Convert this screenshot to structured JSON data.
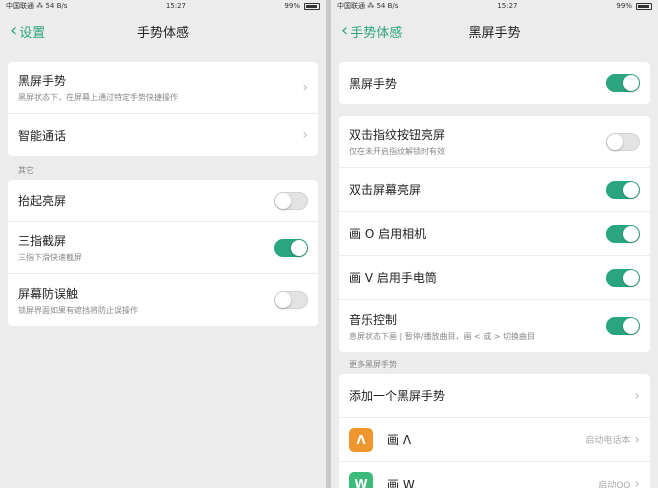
{
  "left": {
    "status": {
      "left": "中国联通 ⁂ 54 B/s",
      "time": "15:27",
      "right": "99%"
    },
    "nav": {
      "back_label": "设置",
      "title": "手势体感"
    },
    "items": [
      {
        "title": "黑屏手势",
        "sub": "黑屏状态下，在屏幕上通过特定手势快捷操作"
      },
      {
        "title": "智能通话"
      }
    ],
    "section_label": "其它",
    "toggles": [
      {
        "title": "抬起亮屏",
        "sub": "",
        "on": false
      },
      {
        "title": "三指截屏",
        "sub": "三指下滑快速截屏",
        "on": true
      },
      {
        "title": "屏幕防误触",
        "sub": "锁屏界面如果有遮挡将防止误操作",
        "on": false
      }
    ]
  },
  "right": {
    "status": {
      "left": "中国联通 ⁂ 54 B/s",
      "time": "15:27",
      "right": "99%"
    },
    "nav": {
      "back_label": "手势体感",
      "title": "黑屏手势"
    },
    "master": {
      "title": "黑屏手势",
      "on": true
    },
    "toggles": [
      {
        "title": "双击指纹按钮亮屏",
        "sub": "仅在未开启指纹解锁时有效",
        "on": false
      },
      {
        "title": "双击屏幕亮屏",
        "sub": "",
        "on": true
      },
      {
        "title": "画 O 启用相机",
        "sub": "",
        "on": true
      },
      {
        "title": "画 V 启用手电筒",
        "sub": "",
        "on": true
      },
      {
        "title": "音乐控制",
        "sub": "息屏状态下画 | 暂停/播放曲目，画 < 或 > 切换曲目",
        "on": true
      }
    ],
    "section_label": "更多黑屏手势",
    "add_label": "添加一个黑屏手势",
    "custom": [
      {
        "icon": "Λ",
        "icon_color": "#f0962e",
        "title": "画 Λ",
        "hint": "启动电话本"
      },
      {
        "icon": "W",
        "icon_color": "#3dbb7a",
        "title": "画 W",
        "hint": "启动QQ"
      }
    ]
  },
  "colors": {
    "accent": "#2aa57f"
  }
}
